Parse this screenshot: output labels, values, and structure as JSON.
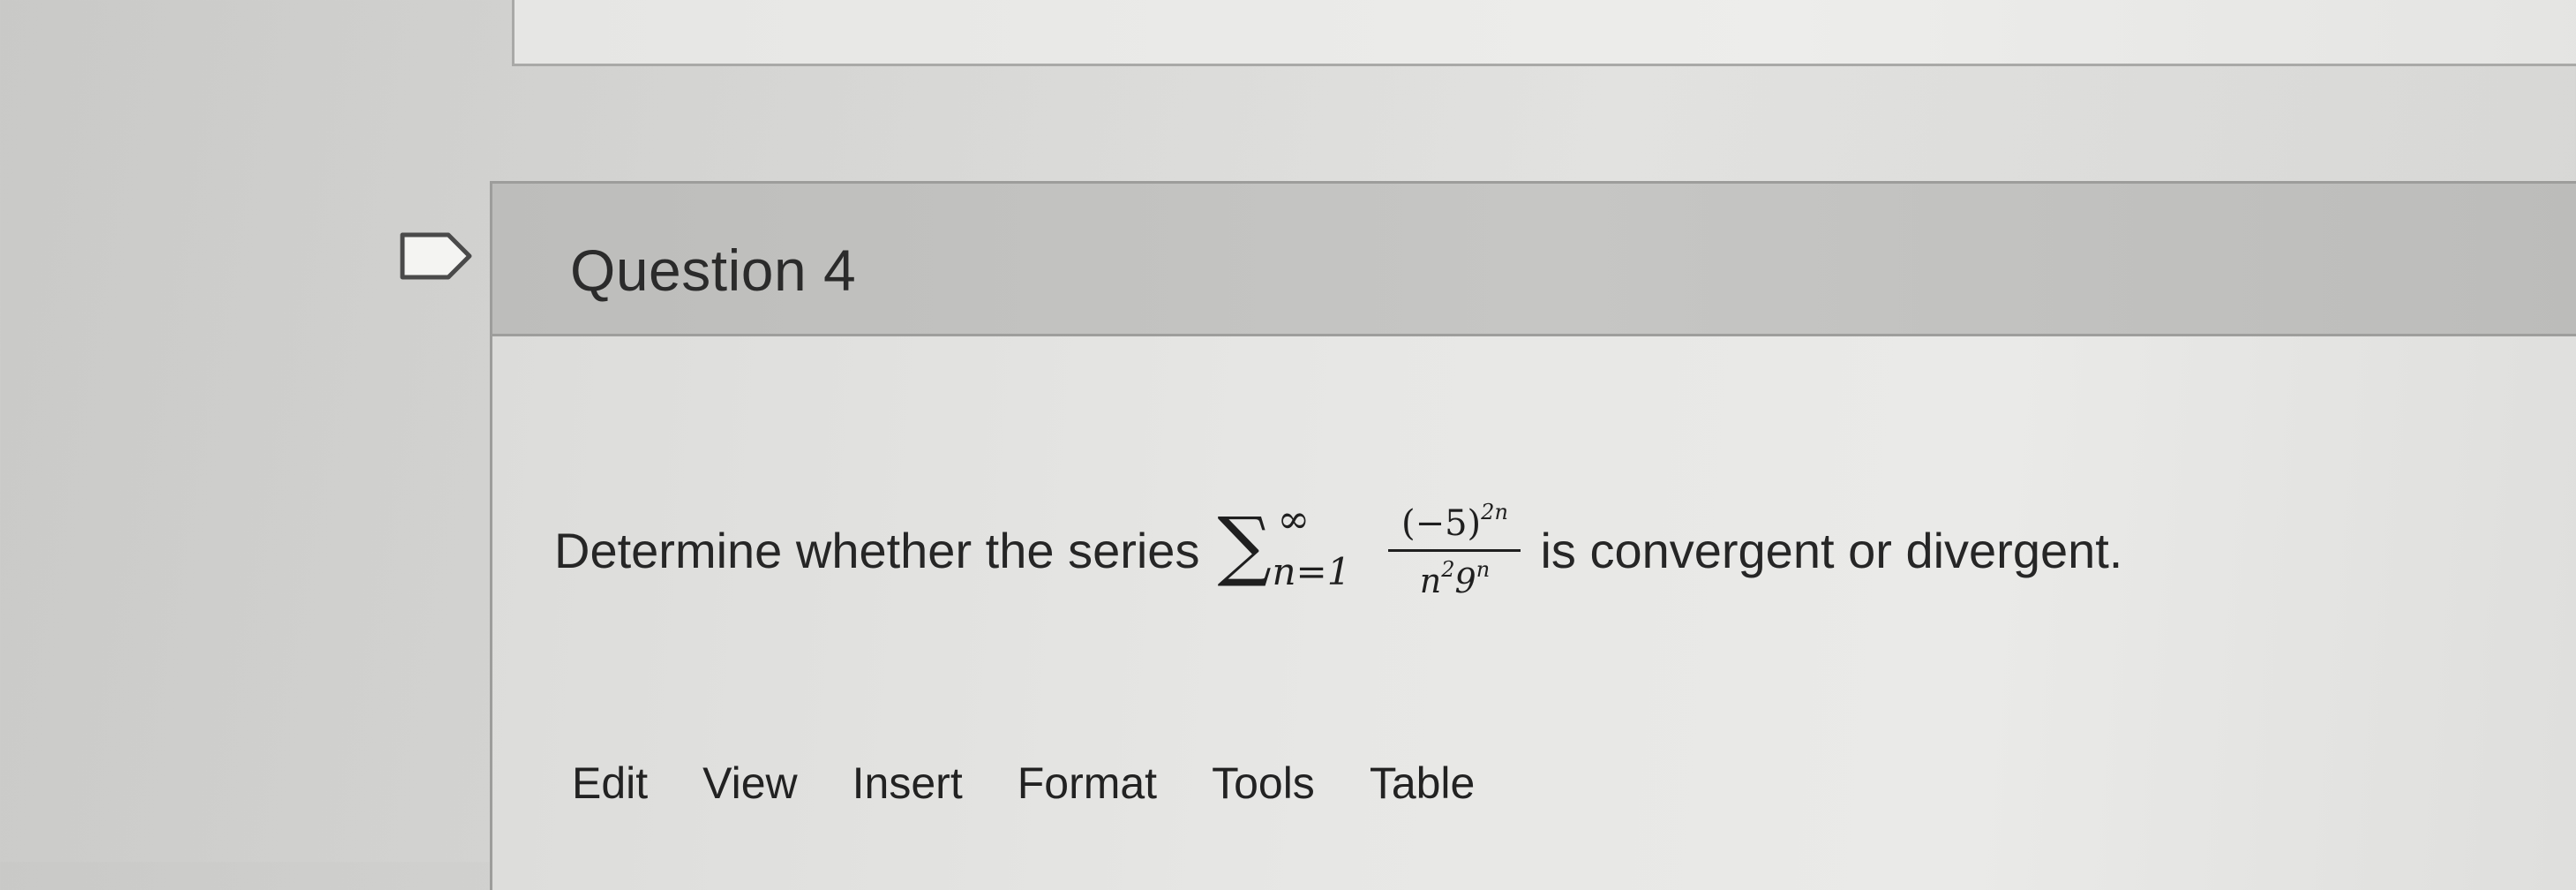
{
  "question": {
    "title": "Question 4",
    "prompt_prefix": "Determine whether the series",
    "prompt_suffix": "is convergent or divergent.",
    "math": {
      "sum_symbol": "∑",
      "upper_limit": "∞",
      "lower_limit": "n=1",
      "numerator": "(−5)",
      "numerator_exponent": "2n",
      "denominator_base_1": "n",
      "denominator_exponent_1": "2",
      "denominator_base_2": "9",
      "denominator_exponent_2": "n"
    }
  },
  "editor_menu": {
    "items": [
      "Edit",
      "View",
      "Insert",
      "Format",
      "Tools",
      "Table"
    ]
  },
  "icons": {
    "flag": "flag-icon"
  }
}
